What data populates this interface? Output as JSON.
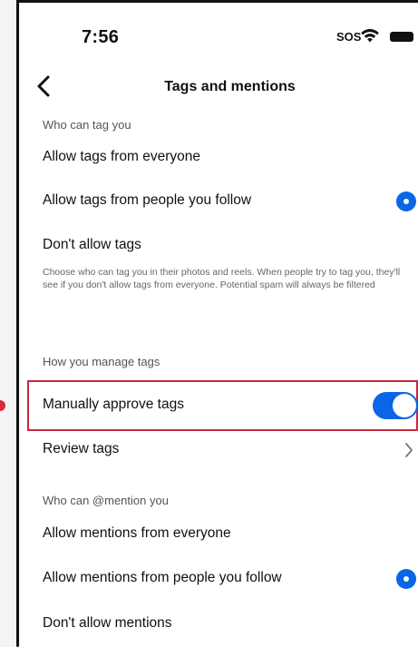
{
  "status_bar": {
    "time": "7:56",
    "sos": "SOS",
    "icons": [
      "wifi-icon",
      "battery-icon"
    ]
  },
  "nav": {
    "back_icon": "chevron-left-icon",
    "title": "Tags and mentions"
  },
  "sections": {
    "tag": {
      "header": "Who can tag you",
      "options": [
        {
          "label": "Allow tags from everyone",
          "selected": false
        },
        {
          "label": "Allow tags from people you follow",
          "selected": true
        },
        {
          "label": "Don't allow tags",
          "selected": false
        }
      ],
      "description": "Choose who can tag you in their photos and reels. When people try to tag you, they'll see if you don't allow tags from everyone. Potential spam will always be filtered"
    },
    "manage": {
      "header": "How you manage tags",
      "manual_approve": {
        "label": "Manually approve tags",
        "enabled": true
      },
      "review": {
        "label": "Review tags",
        "icon": "chevron-right-icon"
      }
    },
    "mention": {
      "header": "Who can @mention you",
      "options": [
        {
          "label": "Allow mentions from everyone",
          "selected": false
        },
        {
          "label": "Allow mentions from people you follow",
          "selected": true
        },
        {
          "label": "Don't allow mentions",
          "selected": false
        }
      ]
    }
  },
  "colors": {
    "accent": "#0a66e6",
    "highlight": "#c8283a"
  }
}
